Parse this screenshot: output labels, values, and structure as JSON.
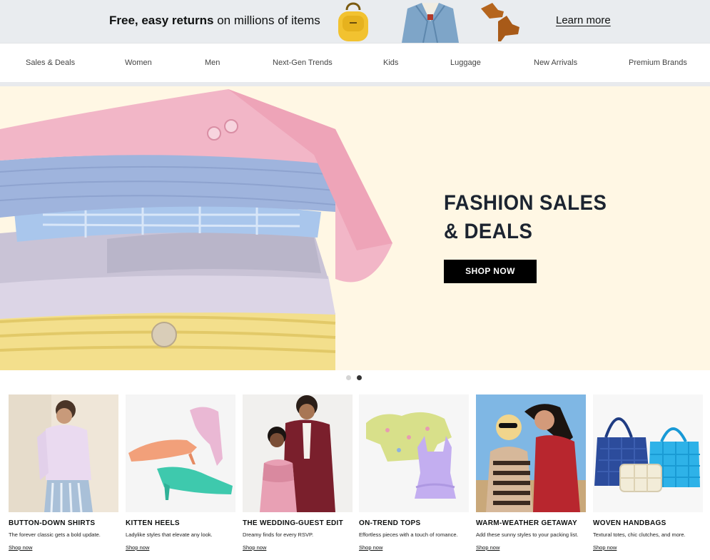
{
  "promo": {
    "text_bold": "Free, easy returns",
    "text_rest": " on millions of items",
    "link": "Learn more"
  },
  "nav": {
    "items": [
      "Sales & Deals",
      "Women",
      "Men",
      "Next-Gen Trends",
      "Kids",
      "Luggage",
      "New Arrivals",
      "Premium Brands"
    ]
  },
  "hero": {
    "title_line1": "FASHION SALES",
    "title_line2": "& DEALS",
    "button": "SHOP NOW",
    "image_icon": "folded-sweaters-stack-image"
  },
  "carousel": {
    "slides": 2,
    "active": 2
  },
  "cards": [
    {
      "title": "BUTTON-DOWN SHIRTS",
      "desc": "The forever classic gets a bold update.",
      "link": "Shop now",
      "image_icon": "button-down-shirt-model-image"
    },
    {
      "title": "KITTEN HEELS",
      "desc": "Ladylike styles that elevate any look.",
      "link": "Shop now",
      "image_icon": "kitten-heels-image"
    },
    {
      "title": "THE WEDDING-GUEST EDIT",
      "desc": "Dreamy finds for every RSVP.",
      "link": "Shop now",
      "image_icon": "wedding-guest-models-image"
    },
    {
      "title": "ON-TREND TOPS",
      "desc": "Effortless pieces with a touch of romance.",
      "link": "Shop now",
      "image_icon": "trend-tops-image"
    },
    {
      "title": "WARM-WEATHER GETAWAY",
      "desc": "Add these sunny styles to your packing list.",
      "link": "Shop now",
      "image_icon": "getaway-models-image"
    },
    {
      "title": "WOVEN HANDBAGS",
      "desc": "Textural totes, chic clutches, and more.",
      "link": "Shop now",
      "image_icon": "woven-handbags-image"
    }
  ],
  "colors": {
    "promo_bg": "#e9ecef",
    "hero_bg": "#fff7e4",
    "hero_title": "#1c2430",
    "button_bg": "#000000"
  }
}
